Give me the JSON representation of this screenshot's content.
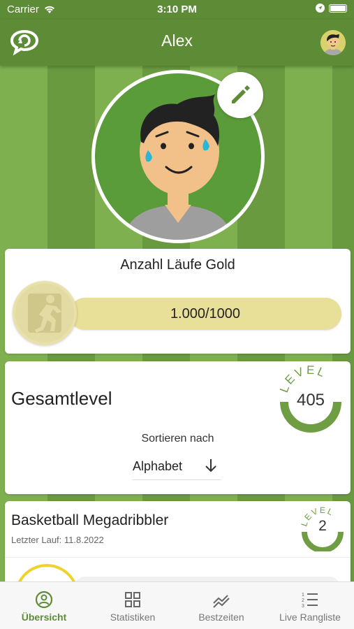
{
  "status": {
    "carrier": "Carrier",
    "time": "3:10 PM"
  },
  "nav": {
    "title": "Alex",
    "logo_icon": "speech-refresh-icon",
    "avatar_icon": "user-avatar-icon"
  },
  "profile": {
    "edit_icon": "pencil-icon"
  },
  "gold_runs": {
    "title": "Anzahl Läufe Gold",
    "progress_text": "1.000/1000",
    "progress_fraction": 1.0,
    "icon": "runner-icon"
  },
  "overall": {
    "heading": "Gesamtlevel",
    "level_label": "LEVEL",
    "level_value": "405",
    "sort_label": "Sortieren nach",
    "sort_value": "Alphabet",
    "sort_icon": "arrow-down-icon"
  },
  "activity": {
    "name": "Basketball Megadribbler",
    "last_run": "Letzter Lauf: 11.8.2022",
    "level_label": "LEVEL",
    "level_value": "2"
  },
  "tabs": [
    {
      "label": "Übersicht",
      "icon": "user-circle-icon",
      "active": true
    },
    {
      "label": "Statistiken",
      "icon": "grid-icon",
      "active": false
    },
    {
      "label": "Bestzeiten",
      "icon": "chart-line-icon",
      "active": false
    },
    {
      "label": "Live Rangliste",
      "icon": "list-numbered-icon",
      "active": false
    }
  ],
  "colors": {
    "primary_green": "#5e8c36",
    "gold_light": "#ece6a0",
    "medal_gold": "#f0d22c"
  }
}
